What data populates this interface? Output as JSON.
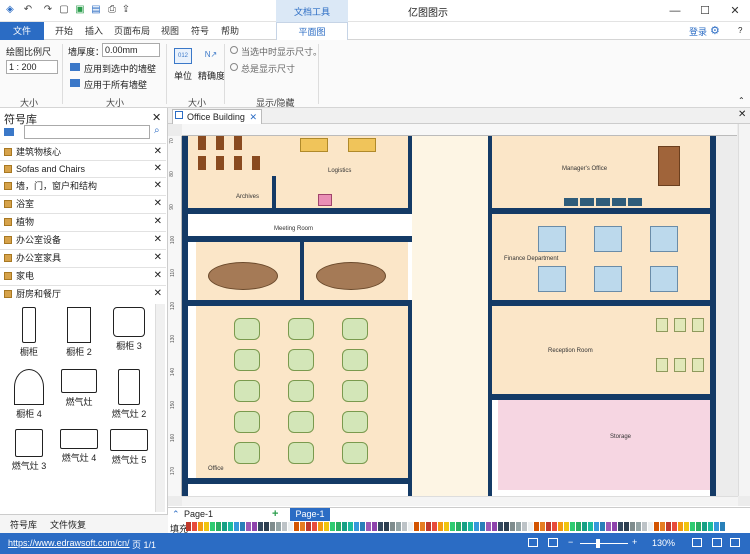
{
  "titlebar": {
    "app_title": "亿图图示",
    "context_tab": "文档工具"
  },
  "tabs": {
    "file": "文件",
    "items": [
      "开始",
      "插入",
      "页面布局",
      "视图",
      "符号",
      "帮助"
    ],
    "active": "平面图"
  },
  "account": {
    "login": "登录"
  },
  "ribbon": {
    "scale_label": "绘图比例尺",
    "scale_value": "1 : 200",
    "group_size1": "大小",
    "wall_thickness_label": "墙厚度：",
    "wall_thickness_value": "0.00mm",
    "apply_selected": "应用到选中的墙壁",
    "apply_all": "应用于所有墙壁",
    "group_size2": "大小",
    "unit_label": "单位",
    "precision_label": "精确度",
    "group_size3": "大小",
    "radio_selected": "当选中时显示尺寸。",
    "radio_always": "总是显示尺寸",
    "group_showhide": "显示/隐藏"
  },
  "library": {
    "title": "符号库",
    "categories": [
      "建筑物核心",
      "Sofas and Chairs",
      "墙，门，窗户和结构",
      "浴室",
      "植物",
      "办公室设备",
      "办公室家具",
      "家电",
      "厨房和餐厅"
    ],
    "shapes": [
      "橱柜",
      "橱柜 2",
      "橱柜 3",
      "橱柜 4",
      "燃气灶",
      "燃气灶 2",
      "燃气灶 3",
      "燃气灶 4",
      "燃气灶 5"
    ]
  },
  "bottom_tabs": {
    "library": "符号库",
    "recovery": "文件恢复"
  },
  "document": {
    "tab": "Office Building"
  },
  "ruler_left": [
    "70",
    "80",
    "90",
    "100",
    "110",
    "120",
    "130",
    "140",
    "150",
    "160",
    "170"
  ],
  "rooms": {
    "logistics": "Logistics",
    "archives": "Archives",
    "manager": "Manager's Office",
    "meeting": "Meeting Room",
    "finance": "Finance Department",
    "reception": "Reception Room",
    "office": "Office",
    "storage": "Storage"
  },
  "pagebar": {
    "page_selector": "Page-1",
    "add": "+",
    "page_tab": "Page-1"
  },
  "fill_label": "填充",
  "status": {
    "url": "https://www.edrawsoft.com/cn/",
    "page": "页 1/1",
    "zoom": "130%"
  },
  "palette": [
    "#c0392b",
    "#e74c3c",
    "#f39c12",
    "#f1c40f",
    "#2ecc71",
    "#27ae60",
    "#16a085",
    "#1abc9c",
    "#3498db",
    "#2980b9",
    "#9b59b6",
    "#8e44ad",
    "#34495e",
    "#2c3e50",
    "#7f8c8d",
    "#95a5a6",
    "#bdc3c7",
    "#ecf0f1",
    "#d35400",
    "#e67e22"
  ]
}
